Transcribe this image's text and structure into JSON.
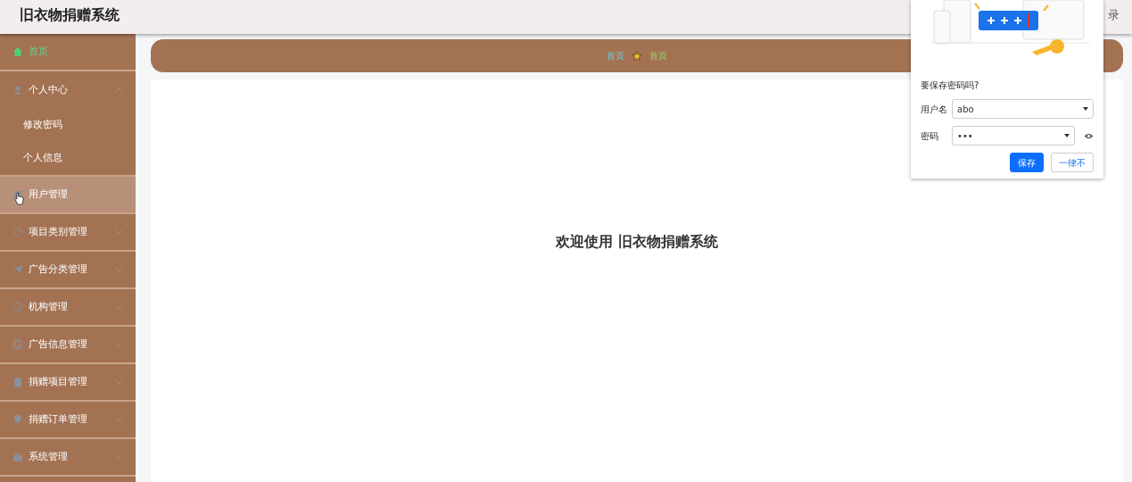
{
  "header": {
    "title": "旧衣物捐赠系统",
    "login_link": "录"
  },
  "sidebar": {
    "items": [
      {
        "kind": "link",
        "label": "首页",
        "selected": true,
        "hovered": false
      },
      {
        "kind": "group",
        "label": "个人中心",
        "expanded": true,
        "hovered": false,
        "children": [
          {
            "label": "修改密码"
          },
          {
            "label": "个人信息"
          }
        ]
      },
      {
        "kind": "group",
        "label": "用户管理",
        "expanded": false,
        "hovered": true
      },
      {
        "kind": "group",
        "label": "项目类别管理",
        "expanded": false,
        "hovered": false
      },
      {
        "kind": "group",
        "label": "广告分类管理",
        "expanded": false,
        "hovered": false
      },
      {
        "kind": "group",
        "label": "机构管理",
        "expanded": false,
        "hovered": false
      },
      {
        "kind": "group",
        "label": "广告信息管理",
        "expanded": false,
        "hovered": false
      },
      {
        "kind": "group",
        "label": "捐赠项目管理",
        "expanded": false,
        "hovered": false
      },
      {
        "kind": "group",
        "label": "捐赠订单管理",
        "expanded": false,
        "hovered": false
      },
      {
        "kind": "group",
        "label": "系统管理",
        "expanded": false,
        "hovered": false
      }
    ]
  },
  "breadcrumb": [
    "首页",
    "首页"
  ],
  "welcome": "欢迎使用 旧衣物捐赠系统",
  "password_popup": {
    "question": "要保存密码吗?",
    "fields": [
      {
        "label": "用户名",
        "value": "abo",
        "reveal": false
      },
      {
        "label": "密码",
        "value": "•••",
        "reveal": true
      }
    ],
    "buttons": [
      {
        "label": "保存",
        "primary": true
      },
      {
        "label": "一律不",
        "primary": false
      }
    ]
  }
}
